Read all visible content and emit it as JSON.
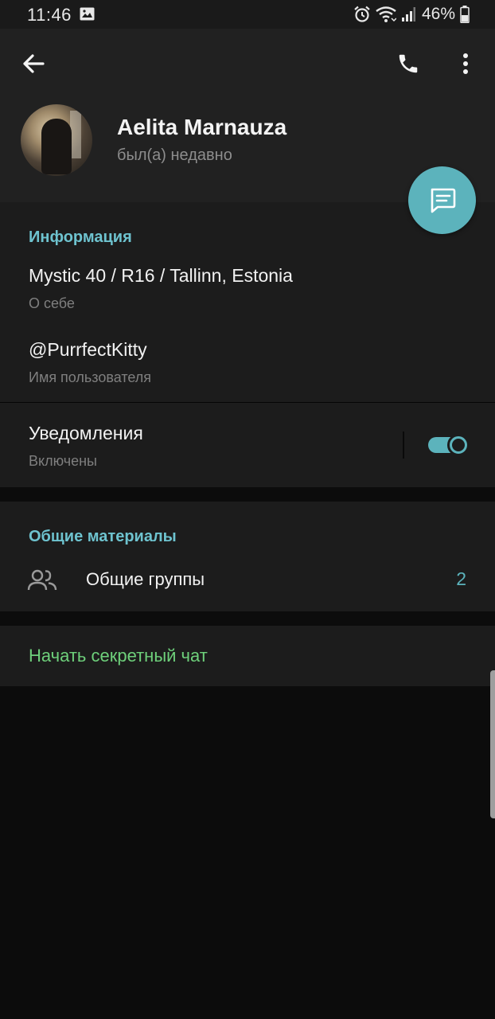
{
  "status_bar": {
    "time": "11:46",
    "battery": "46%",
    "icons": [
      "image-icon",
      "alarm-icon",
      "wifi-icon",
      "signal-icon",
      "battery-icon"
    ]
  },
  "header": {
    "icons": [
      "arrow-left-icon",
      "phone-icon",
      "more-vertical-icon"
    ],
    "name": "Aelita Marnauza",
    "status": "был(а) недавно"
  },
  "fab": {
    "icon": "message-icon"
  },
  "info": {
    "title": "Информация",
    "bio": "Mystic 40 / R16 / Tallinn, Estonia",
    "bio_caption": "О себе",
    "username": "@PurrfectKitty",
    "username_caption": "Имя пользователя",
    "notifications": "Уведомления",
    "notifications_caption": "Включены",
    "notifications_enabled": true
  },
  "shared": {
    "title": "Общие материалы",
    "groups_label": "Общие группы",
    "groups_count": "2",
    "groups_icon": "users-icon"
  },
  "secret": {
    "label": "Начать секретный чат"
  },
  "colors": {
    "accent": "#5cb3bc",
    "section_title": "#6ec3cf",
    "secret_chat": "#6ed07b",
    "background": "#0c0c0c",
    "surface": "#1c1c1c",
    "header": "#212121"
  }
}
